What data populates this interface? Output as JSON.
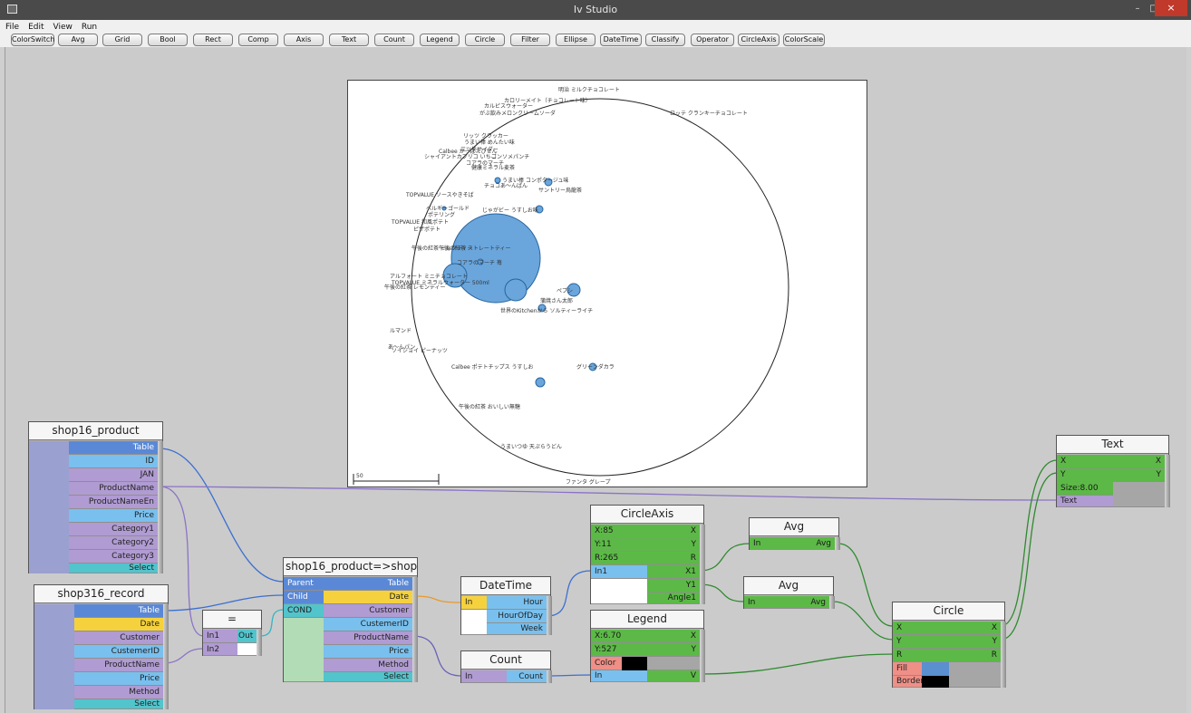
{
  "window": {
    "title": "Iv Studio",
    "minimize": "–",
    "maximize": "□",
    "close": "×"
  },
  "menu": [
    "File",
    "Edit",
    "View",
    "Run"
  ],
  "toolbar": [
    "ColorSwitch",
    "Avg",
    "Grid",
    "Bool",
    "Rect",
    "Comp",
    "Axis",
    "Text",
    "Count",
    "Legend",
    "Circle",
    "Filter",
    "Ellipse",
    "DateTime",
    "Classify",
    "Operator",
    "CircleAxis",
    "ColorScale"
  ],
  "plot": {
    "scale_label": "50",
    "labels": [
      "明治 ミルクチョコレート",
      "カロリーメイト（チョコレート味）",
      "カルピスウォーター",
      "がぶ飲みメロンクリームソーダ",
      "ロッテ クランキーチョコレート",
      "リッツ クラッカー",
      "うまい棒 めんたい味",
      "三ツ矢サイダー",
      "Calbee かっぱえびせん",
      "シャイアントカプリコ いちご",
      "コンソメパンチ",
      "コアラのマーチ",
      "健康ミネラル麦茶",
      "サントリー烏龍茶",
      "うまい棒 コンポタージュ味",
      "チョコあ～んぱん",
      "TOPVALUE ソースやきそば",
      "ベルギーゴールド",
      "ポテリング",
      "じゃがビー うすしお味",
      "TOPVALUE 和風ポテト",
      "ピザポテト",
      "午後の紅茶 ミルクティー",
      "午後の紅茶 ストレートティー",
      "コアラのマーチ 苺",
      "アルフォート ミニチョコレート",
      "TOPVALUE ミネラルウォーター 500ml",
      "午後の紅茶 レモンティー",
      "ペプシ",
      "蒲焼さん太郎",
      "世界のKitchenから ソルティーライチ",
      "ルマンド",
      "あ～んパン",
      "ソイジョイ ピーナッツ",
      "Calbee ポテトチップス うすしお",
      "グリーンダカラ",
      "午後の紅茶 おいしい無糖",
      "うまいつゆ 天ぷらうどん",
      "ファンタ グレープ"
    ]
  },
  "nodes": {
    "shop16_product": {
      "title": "shop16_product",
      "ports": [
        "Table",
        "ID",
        "JAN",
        "ProductName",
        "ProductNameEn",
        "Price",
        "Category1",
        "Category2",
        "Category3",
        "Select"
      ]
    },
    "shop316_record": {
      "title": "shop316_record",
      "ports": [
        "Table",
        "Date",
        "Customer",
        "CustemerID",
        "ProductName",
        "Price",
        "Method",
        "Select"
      ]
    },
    "eq": {
      "title": "=",
      "in1": "In1",
      "in2": "In2",
      "out": "Out"
    },
    "join": {
      "title": "shop16_product=>shop316_record",
      "left": [
        "Parent",
        "Child",
        "COND"
      ],
      "right": [
        "Table",
        "Date",
        "Customer",
        "CustemerID",
        "ProductName",
        "Price",
        "Method",
        "Select"
      ]
    },
    "datetime": {
      "title": "DateTime",
      "in": "In",
      "outs": [
        "Hour",
        "HourOfDay",
        "Week"
      ]
    },
    "count": {
      "title": "Count",
      "in": "In",
      "out": "Count"
    },
    "circleaxis": {
      "title": "CircleAxis",
      "x": "X:85",
      "y": "Y:11",
      "r": "R:265",
      "in1": "In1",
      "outs": [
        "X",
        "Y",
        "R",
        "X1",
        "Y1",
        "Angle1"
      ]
    },
    "legend": {
      "title": "Legend",
      "x": "X:6.70",
      "y": "Y:527",
      "color": "Color",
      "in": "In",
      "outs": [
        "X",
        "Y",
        "V"
      ]
    },
    "avg1": {
      "title": "Avg",
      "in": "In",
      "out": "Avg"
    },
    "avg2": {
      "title": "Avg",
      "in": "In",
      "out": "Avg"
    },
    "circle": {
      "title": "Circle",
      "ins": [
        "X",
        "Y",
        "R"
      ],
      "fill": "Fill",
      "border": "Border",
      "outs": [
        "X",
        "Y",
        "R"
      ]
    },
    "text": {
      "title": "Text",
      "ins": [
        "X",
        "Y"
      ],
      "size": "Size:8.00",
      "text": "Text",
      "outs": [
        "X",
        "Y"
      ]
    }
  }
}
